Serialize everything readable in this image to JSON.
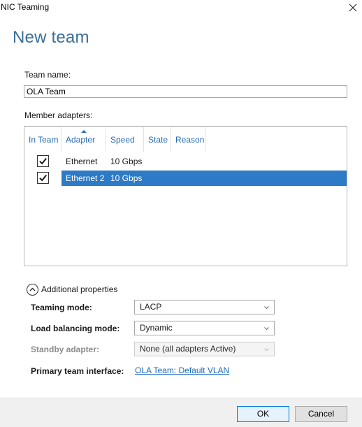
{
  "window": {
    "title": "NIC Teaming"
  },
  "heading": "New team",
  "team_name": {
    "label": "Team name:",
    "value": "OLA Team"
  },
  "members": {
    "label": "Member adapters:",
    "columns": [
      "In Team",
      "Adapter",
      "Speed",
      "State",
      "Reason"
    ],
    "rows": [
      {
        "checked": true,
        "adapter": "Ethernet",
        "speed": "10 Gbps",
        "state": "",
        "reason": "",
        "selected": false
      },
      {
        "checked": true,
        "adapter": "Ethernet 2",
        "speed": "10 Gbps",
        "state": "",
        "reason": "",
        "selected": true
      }
    ]
  },
  "additional": {
    "toggle_label": "Additional properties",
    "teaming_mode": {
      "label": "Teaming mode:",
      "value": "LACP"
    },
    "load_balancing": {
      "label": "Load balancing mode:",
      "value": "Dynamic"
    },
    "standby_adapter": {
      "label": "Standby adapter:",
      "value": "None (all adapters Active)"
    },
    "primary_interface": {
      "label": "Primary team interface:",
      "link": "OLA Team: Default VLAN"
    }
  },
  "buttons": {
    "ok": "OK",
    "cancel": "Cancel"
  },
  "colors": {
    "heading": "#3b6e98",
    "accent": "#2d7ac7",
    "link": "#1c6bbf",
    "column_header": "#2a6db6"
  }
}
